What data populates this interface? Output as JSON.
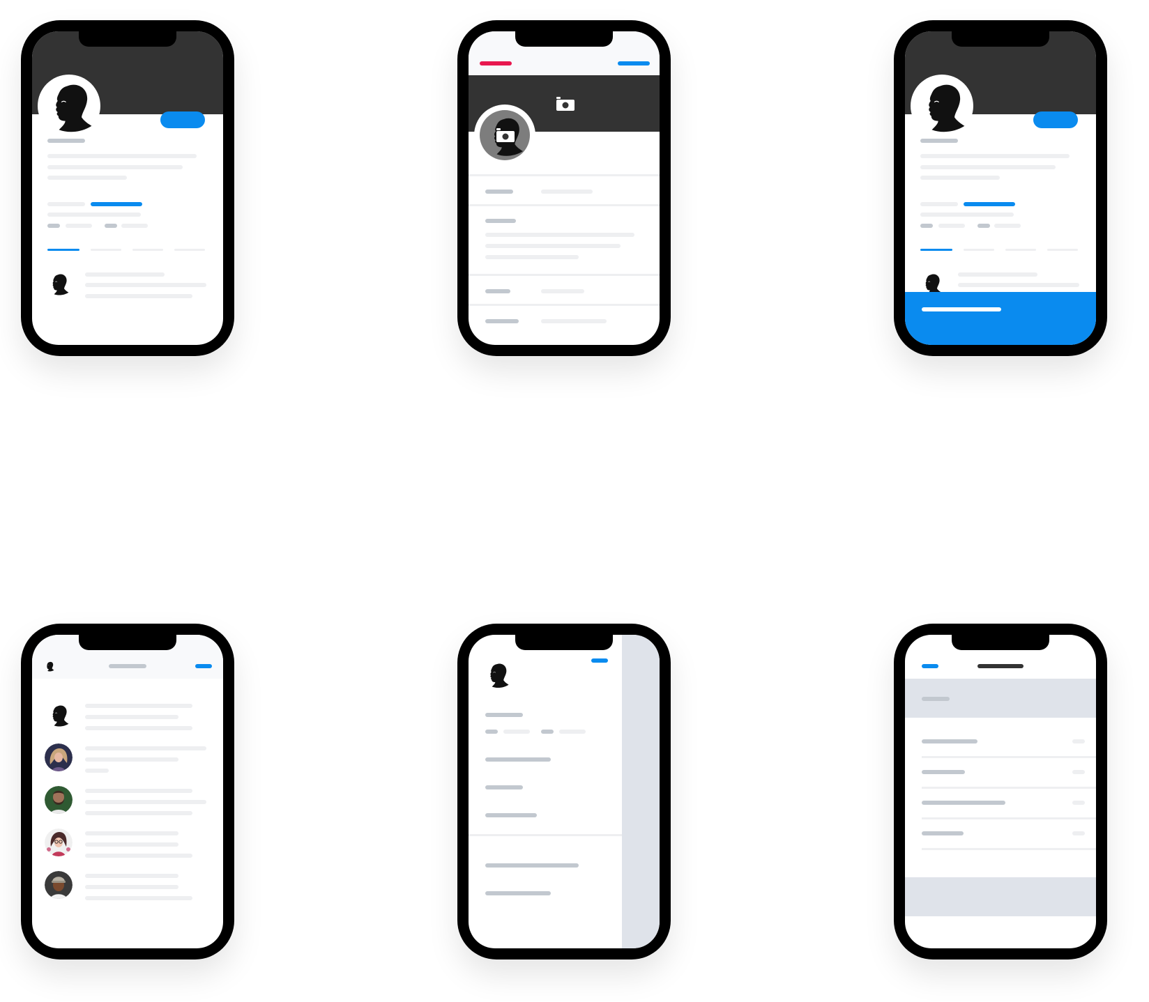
{
  "canvas": {
    "background": "#ffffff"
  },
  "colors": {
    "device_frame": "#000000",
    "cover": "#333333",
    "accent_blue": "#0a8bef",
    "accent_red": "#e8184f",
    "placeholder_light": "#eeeff1",
    "placeholder_dark": "#c2c8cf",
    "panel_gray": "#dfe3ea"
  },
  "screens": [
    {
      "id": "profile",
      "icons": [
        "avatar-silhouette-icon"
      ]
    },
    {
      "id": "edit-profile",
      "icons": [
        "camera-icon",
        "avatar-silhouette-icon"
      ]
    },
    {
      "id": "profile-with-banner",
      "icons": [
        "avatar-silhouette-icon"
      ]
    },
    {
      "id": "feed-list",
      "icons": [
        "avatar-silhouette-icon",
        "avatar-photo-woman-icon",
        "avatar-photo-bearded-man-icon",
        "avatar-photo-woman-glasses-icon",
        "avatar-photo-man-cap-icon"
      ]
    },
    {
      "id": "side-drawer",
      "icons": [
        "avatar-silhouette-icon"
      ]
    },
    {
      "id": "settings-list",
      "icons": []
    }
  ]
}
